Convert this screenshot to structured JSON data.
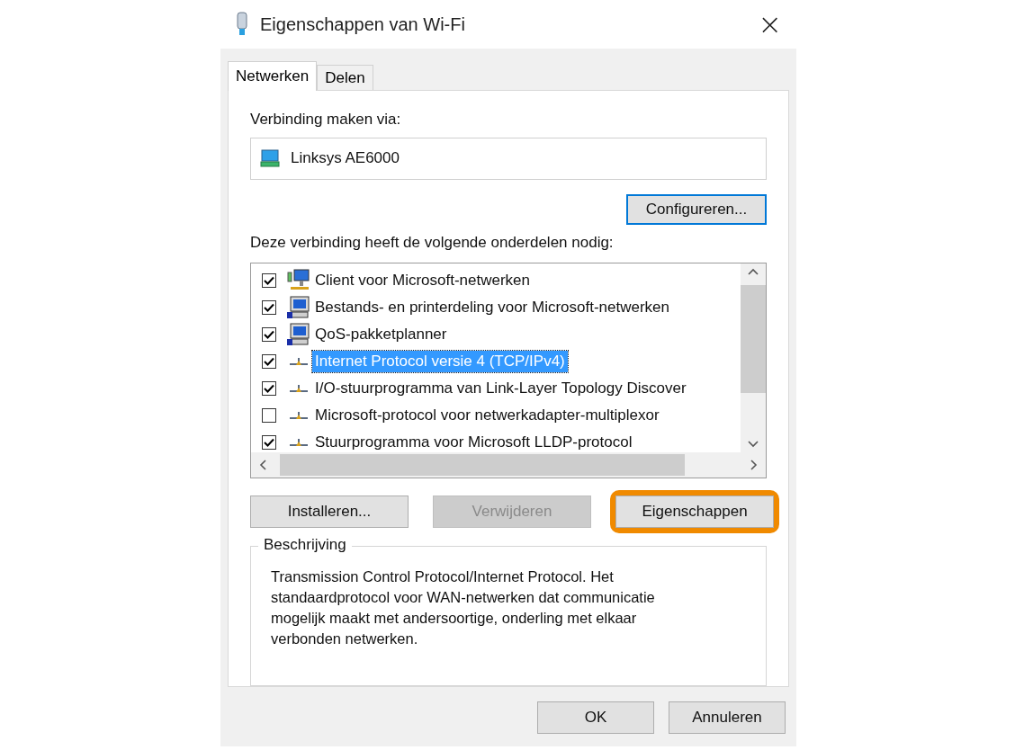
{
  "window": {
    "title": "Eigenschappen van Wi-Fi",
    "close": "×"
  },
  "tabs": [
    {
      "label": "Netwerken",
      "selected": true
    },
    {
      "label": "Delen",
      "selected": false
    }
  ],
  "connect_via": {
    "label": "Verbinding maken via:",
    "adapter": "Linksys AE6000",
    "configure_button": "Configureren..."
  },
  "components": {
    "label": "Deze verbinding heeft de volgende onderdelen nodig:",
    "items": [
      {
        "kind": "client",
        "label": "Client voor Microsoft-netwerken",
        "checked": true,
        "selected": false
      },
      {
        "kind": "computer",
        "label": "Bestands- en printerdeling voor Microsoft-netwerken",
        "checked": true,
        "selected": false
      },
      {
        "kind": "computer",
        "label": "QoS-pakketplanner",
        "checked": true,
        "selected": false
      },
      {
        "kind": "protocol",
        "label": "Internet Protocol versie 4 (TCP/IPv4)",
        "checked": true,
        "selected": true
      },
      {
        "kind": "protocol",
        "label": "I/O-stuurprogramma van Link-Layer Topology Discover",
        "checked": true,
        "selected": false
      },
      {
        "kind": "protocol",
        "label": "Microsoft-protocol voor netwerkadapter-multiplexor",
        "checked": false,
        "selected": false
      },
      {
        "kind": "protocol",
        "label": "Stuurprogramma voor Microsoft LLDP-protocol",
        "checked": true,
        "selected": false
      }
    ]
  },
  "action_buttons": [
    {
      "label": "Installeren...",
      "disabled": false,
      "highlighted": false
    },
    {
      "label": "Verwijderen",
      "disabled": true,
      "highlighted": false
    },
    {
      "label": "Eigenschappen",
      "disabled": false,
      "highlighted": true
    }
  ],
  "description": {
    "title": "Beschrijving",
    "text": "Transmission Control Protocol/Internet Protocol. Het standaardprotocol voor WAN-netwerken dat communicatie mogelijk maakt met andersoortige, onderling met elkaar verbonden netwerken."
  },
  "dialog_buttons": [
    "OK",
    "Annuleren"
  ]
}
